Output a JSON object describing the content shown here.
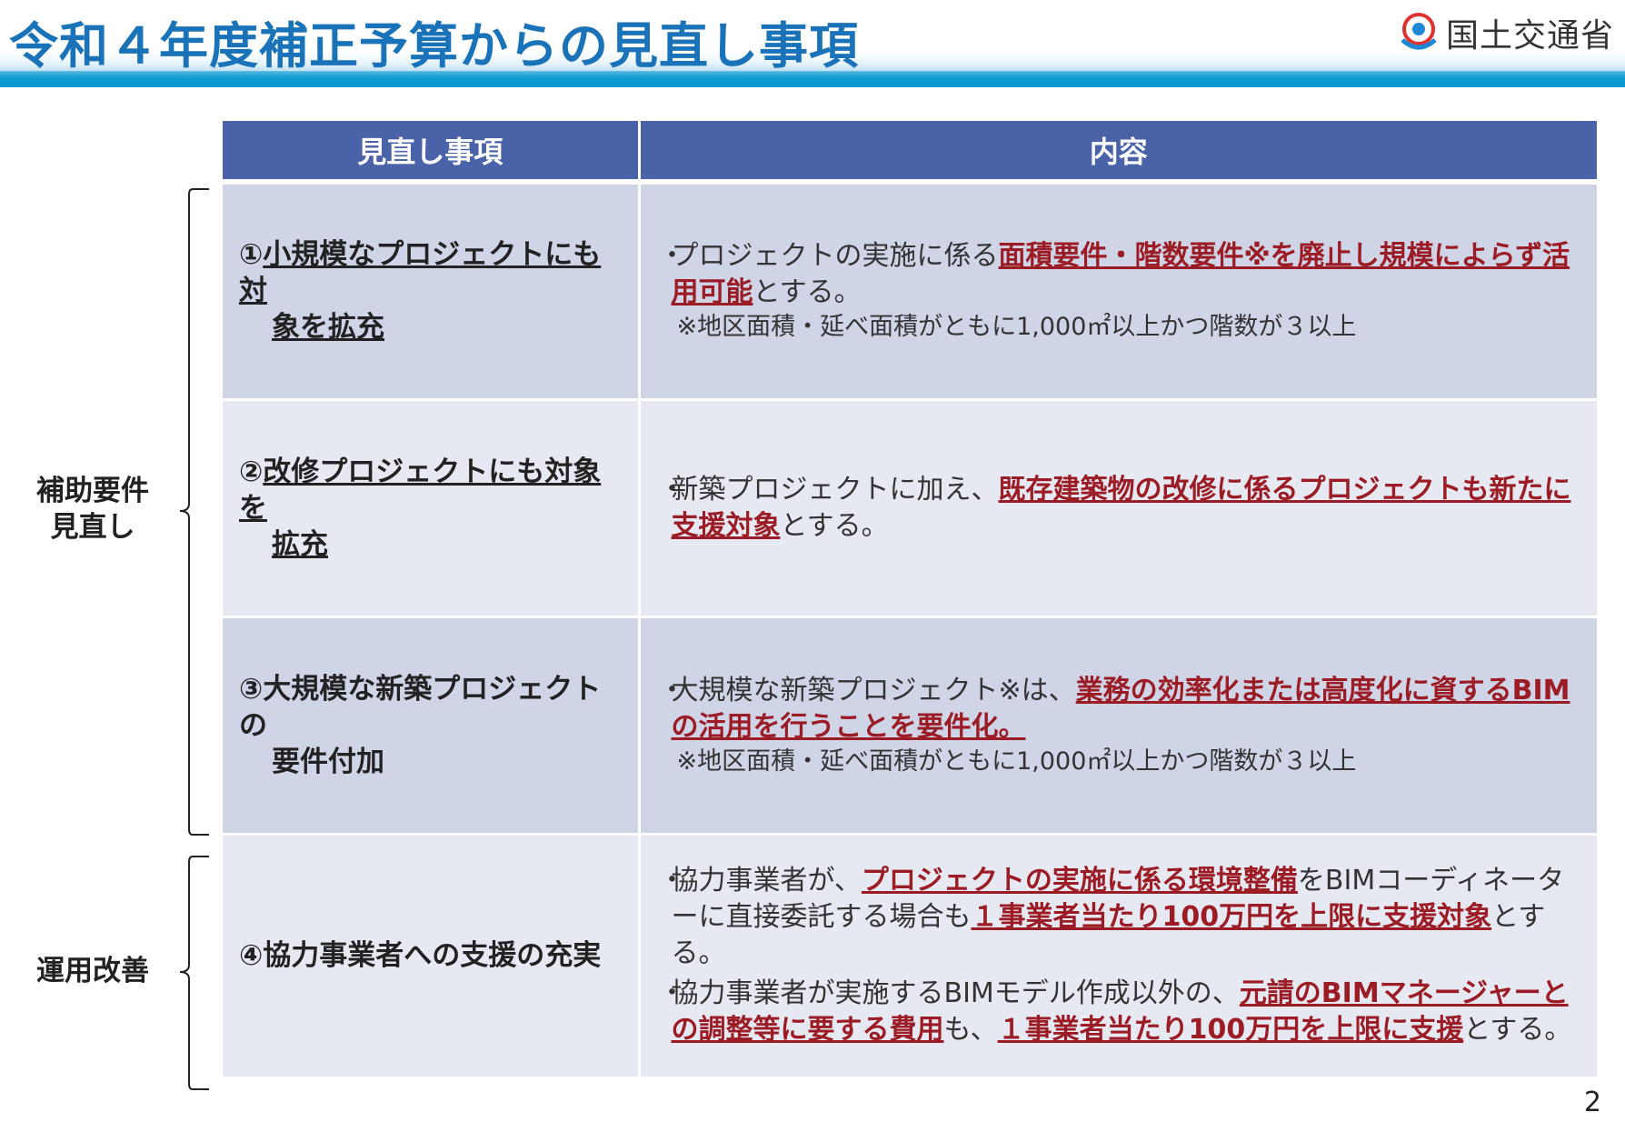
{
  "header": {
    "title": "令和４年度補正予算からの見直し事項",
    "logo_text": "国土交通省"
  },
  "table": {
    "col_headers": [
      "見直し事項",
      "内容"
    ],
    "rows": [
      {
        "num": "①",
        "title_line1": "小規模なプロジェクトにも対",
        "title_line2": "象を拡充",
        "text_a": "プロジェクトの実施に係る",
        "hl_a": "面積要件・階数要件※を廃止し規模によらず活用可能",
        "text_b": "とする。",
        "note": "※地区面積・延べ面積がともに1,000㎡以上かつ階数が３以上"
      },
      {
        "num": "②",
        "title_line1": "改修プロジェクトにも対象を",
        "title_line2": "拡充",
        "text_a": "新築プロジェクトに加え、",
        "hl_a": "既存建築物の改修に係るプロジェクトも新たに支援対象",
        "text_b": "とする。"
      },
      {
        "num": "③",
        "title_line1": "大規模な新築プロジェクトの",
        "title_line2": "要件付加",
        "text_a": "大規模な新築プロジェクト※は、",
        "hl_a": "業務の効率化または高度化に資するBIMの活用を行うことを要件化。",
        "note": "※地区面積・延べ面積がともに1,000㎡以上かつ階数が３以上"
      },
      {
        "num": "④",
        "title_line1": "協力事業者への支援の充実",
        "p1_a": "協力事業者が、",
        "p1_hl1": "プロジェクトの実施に係る環境整備",
        "p1_b": "をBIMコーディネーターに直接委託する場合も",
        "p1_hl2": "１事業者当たり100万円を上限に支援対象",
        "p1_c": "とする。",
        "p2_a": "協力事業者が実施するBIMモデル作成以外の、",
        "p2_hl1": "元請のBIMマネージャーとの調整等に要する費用",
        "p2_b": "も、",
        "p2_hl2": "１事業者当たり100万円を上限に支援",
        "p2_c": "とする。"
      }
    ]
  },
  "side_labels": {
    "group1_line1": "補助要件",
    "group1_line2": "見直し",
    "group2": "運用改善"
  },
  "page_number": "2",
  "bullet": "・",
  "colors": {
    "title": "#1a73b8",
    "header_bg": "#4a63a8",
    "row_dark": "#cfd4e6",
    "row_light": "#e7e9f2",
    "highlight": "#9b1c24"
  },
  "icons": [
    "mlit-logo-icon"
  ]
}
